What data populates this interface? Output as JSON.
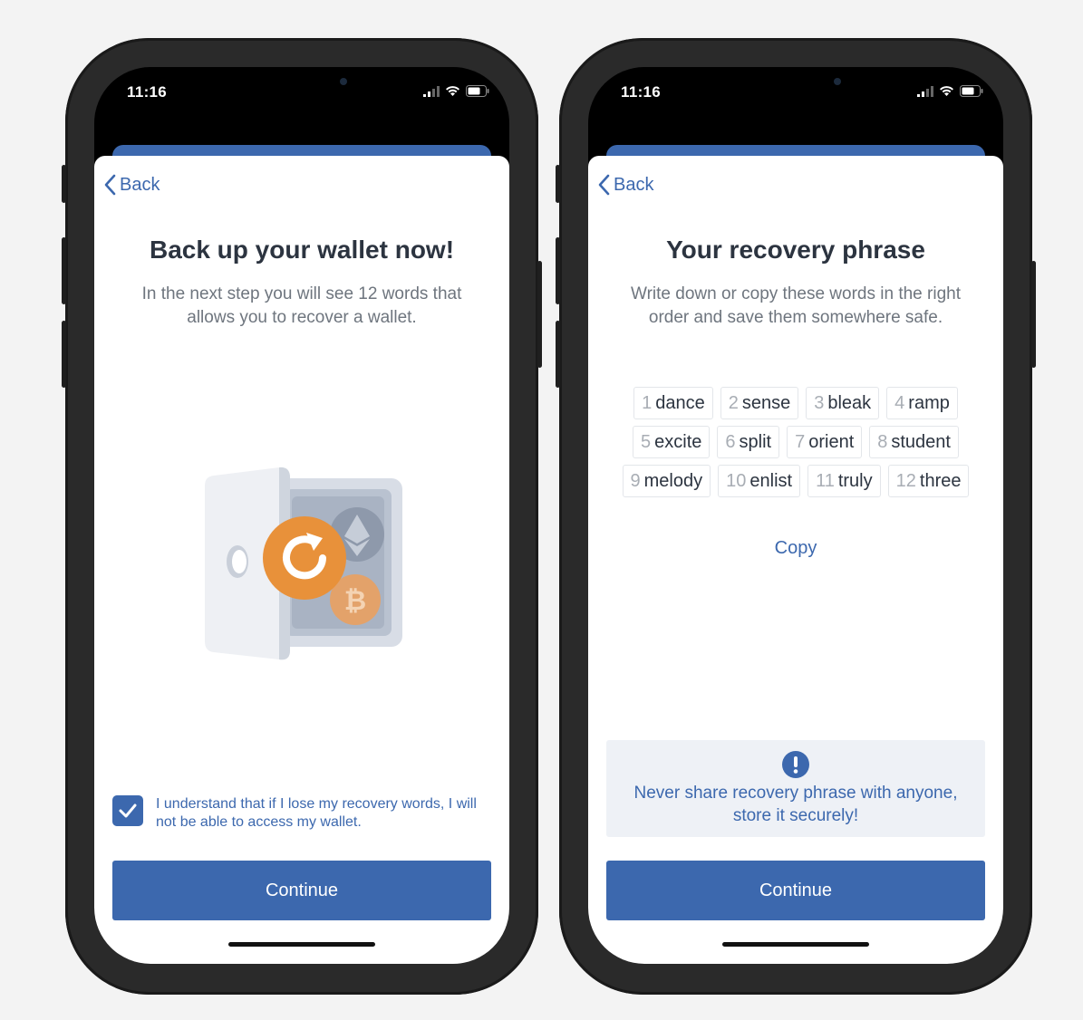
{
  "status": {
    "time": "11:16"
  },
  "screen1": {
    "back_label": "Back",
    "title": "Back up your wallet now!",
    "subtitle": "In the next step you will see 12 words that allows you to recover a wallet.",
    "consent_checked": true,
    "consent_text": "I understand that if I lose my recovery words, I will not be able to access my wallet.",
    "continue_label": "Continue"
  },
  "screen2": {
    "back_label": "Back",
    "title": "Your recovery phrase",
    "subtitle": "Write down or copy these words in the right order and save them somewhere safe.",
    "words": [
      {
        "num": "1",
        "word": "dance"
      },
      {
        "num": "2",
        "word": "sense"
      },
      {
        "num": "3",
        "word": "bleak"
      },
      {
        "num": "4",
        "word": "ramp"
      },
      {
        "num": "5",
        "word": "excite"
      },
      {
        "num": "6",
        "word": "split"
      },
      {
        "num": "7",
        "word": "orient"
      },
      {
        "num": "8",
        "word": "student"
      },
      {
        "num": "9",
        "word": "melody"
      },
      {
        "num": "10",
        "word": "enlist"
      },
      {
        "num": "11",
        "word": "truly"
      },
      {
        "num": "12",
        "word": "three"
      }
    ],
    "copy_label": "Copy",
    "warning_text": "Never share recovery phrase with anyone, store it securely!",
    "continue_label": "Continue"
  },
  "colors": {
    "accent": "#3c68ae",
    "vault_orange": "#e8913a",
    "warning_bg": "#eef1f6"
  },
  "icons": [
    "chevron-left-icon",
    "signal-icon",
    "wifi-icon",
    "battery-icon",
    "checkmark-icon",
    "vault-illustration",
    "exclamation-icon"
  ]
}
